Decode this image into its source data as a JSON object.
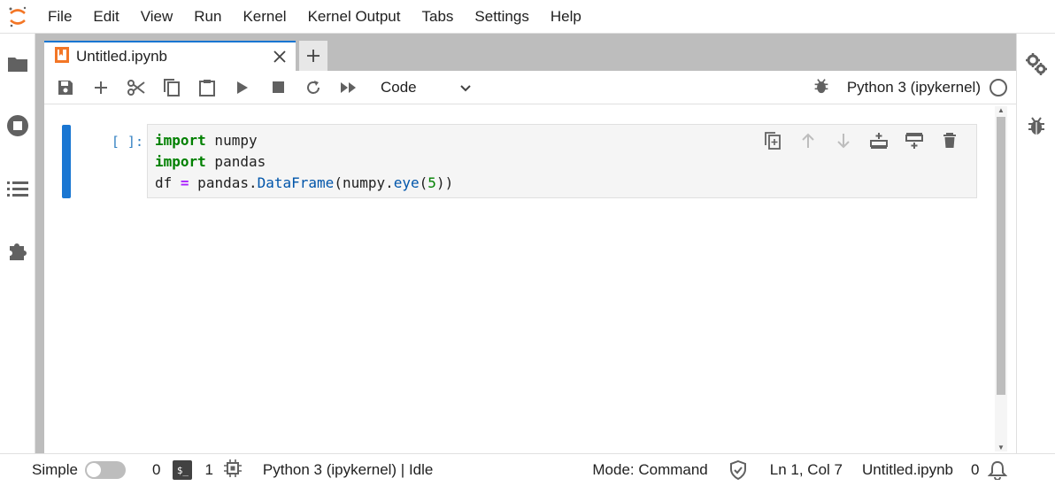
{
  "menu": [
    "File",
    "Edit",
    "View",
    "Run",
    "Kernel",
    "Kernel Output",
    "Tabs",
    "Settings",
    "Help"
  ],
  "tab": {
    "title": "Untitled.ipynb"
  },
  "toolbar": {
    "cell_type": "Code",
    "kernel_name": "Python 3 (ipykernel)"
  },
  "cell": {
    "prompt": "[ ]:",
    "code": {
      "line1_kw": "import",
      "line1_rest": " numpy",
      "line2_kw": "import",
      "line2_rest": " pandas",
      "line3_a": "df ",
      "line3_op": "=",
      "line3_b": " pandas.",
      "line3_fn1": "DataFrame",
      "line3_c": "(numpy.",
      "line3_fn2": "eye",
      "line3_d": "(",
      "line3_num": "5",
      "line3_e": "))"
    }
  },
  "status": {
    "mode_label": "Simple",
    "simple_mode_on": false,
    "terminals_count": "0",
    "kernels_count": "1",
    "kernel_status": "Python 3 (ipykernel) | Idle",
    "mode": "Mode: Command",
    "cursor": "Ln 1, Col 7",
    "filename": "Untitled.ipynb",
    "notifications": "0",
    "terminal_badge": "$_"
  },
  "colors": {
    "accent": "#1976d2",
    "cell_indicator": "#1976d2",
    "jupyter_orange": "#f37626"
  }
}
